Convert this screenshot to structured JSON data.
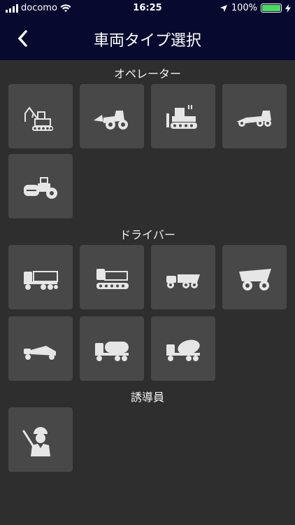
{
  "status": {
    "carrier": "docomo",
    "time": "16:25",
    "battery": "100%"
  },
  "nav": {
    "title": "車両タイプ選択"
  },
  "sections": [
    {
      "title": "オペレーター",
      "items": [
        "excavator-icon",
        "wheel-loader-icon",
        "bulldozer-icon",
        "motor-grader-icon",
        "road-roller-icon"
      ]
    },
    {
      "title": "ドライバー",
      "items": [
        "dump-truck-icon",
        "crawler-carrier-icon",
        "articulated-dump-icon",
        "rigid-dump-icon",
        "scraper-icon",
        "tanker-truck-icon",
        "concrete-mixer-icon"
      ]
    },
    {
      "title": "誘導員",
      "items": [
        "flagman-icon"
      ]
    }
  ]
}
